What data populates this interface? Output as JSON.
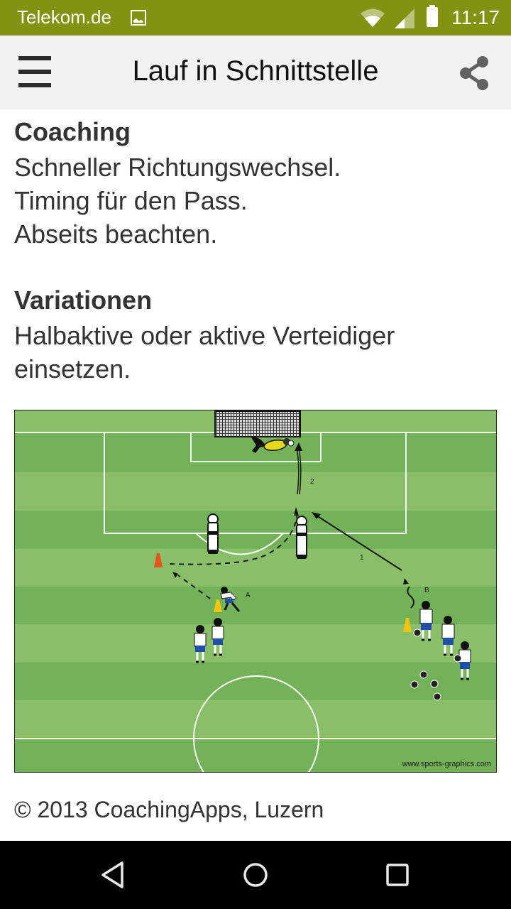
{
  "status_bar": {
    "carrier": "Telekom.de",
    "time": "11:17",
    "icons": [
      "image-notification-icon",
      "wifi-icon",
      "signal-icon",
      "battery-icon"
    ]
  },
  "app_bar": {
    "title": "Lauf in Schnittstelle",
    "menu_icon": "hamburger-menu-icon",
    "share_icon": "share-icon"
  },
  "sections": [
    {
      "heading": "Coaching",
      "lines": [
        "Schneller Richtungswechsel.",
        "Timing für den Pass.",
        "Abseits beachten."
      ]
    },
    {
      "heading": "Variationen",
      "lines": [
        "Halbaktive oder aktive Verteidiger",
        "einsetzen."
      ]
    }
  ],
  "diagram": {
    "labels": {
      "pass_1": "1",
      "pass_2": "2",
      "group_a": "A",
      "group_b": "B"
    },
    "watermark": "www.sports-graphics.com",
    "colors": {
      "grass_light": "#8ABF6A",
      "grass_dark": "#74B25A",
      "cone_orange": "#E8541C",
      "cone_yellow": "#F2C50C",
      "keeper_yellow": "#E8D81A",
      "shorts_blue": "#1F4FA8"
    }
  },
  "footer": {
    "copyright": "© 2013 CoachingApps, Luzern"
  },
  "nav_bar": {
    "buttons": [
      "back-icon",
      "home-icon",
      "recents-icon"
    ]
  }
}
